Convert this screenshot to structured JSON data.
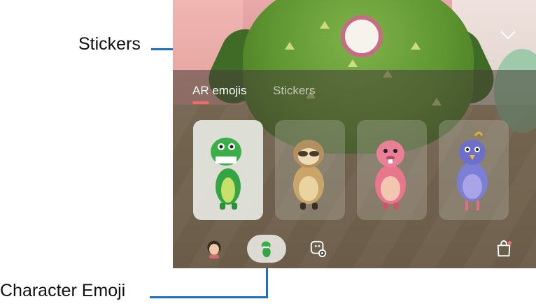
{
  "callouts": {
    "stickers": "Stickers",
    "character_emoji": "Character Emoji"
  },
  "tabs": [
    {
      "label": "AR emojis",
      "selected": true
    },
    {
      "label": "Stickers",
      "selected": false
    }
  ],
  "characters": [
    {
      "name": "dinosaur",
      "color": "#3aa845",
      "selected": true
    },
    {
      "name": "sloth",
      "color": "#c9a56a",
      "selected": false
    },
    {
      "name": "beaver",
      "color": "#e8778d",
      "selected": false
    },
    {
      "name": "bird",
      "color": "#7b7fd6",
      "selected": false
    }
  ],
  "bottom_bar": [
    {
      "name": "my-emoji-avatar",
      "icon": "avatar-icon"
    },
    {
      "name": "character-emoji",
      "icon": "dinosaur-icon",
      "selected": true
    },
    {
      "name": "sticker-settings",
      "icon": "sticker-gear-icon"
    },
    {
      "name": "store",
      "icon": "shopping-bag-icon"
    }
  ],
  "colors": {
    "accent_indicator": "#f06b67",
    "callout_line": "#1c6fbf"
  }
}
